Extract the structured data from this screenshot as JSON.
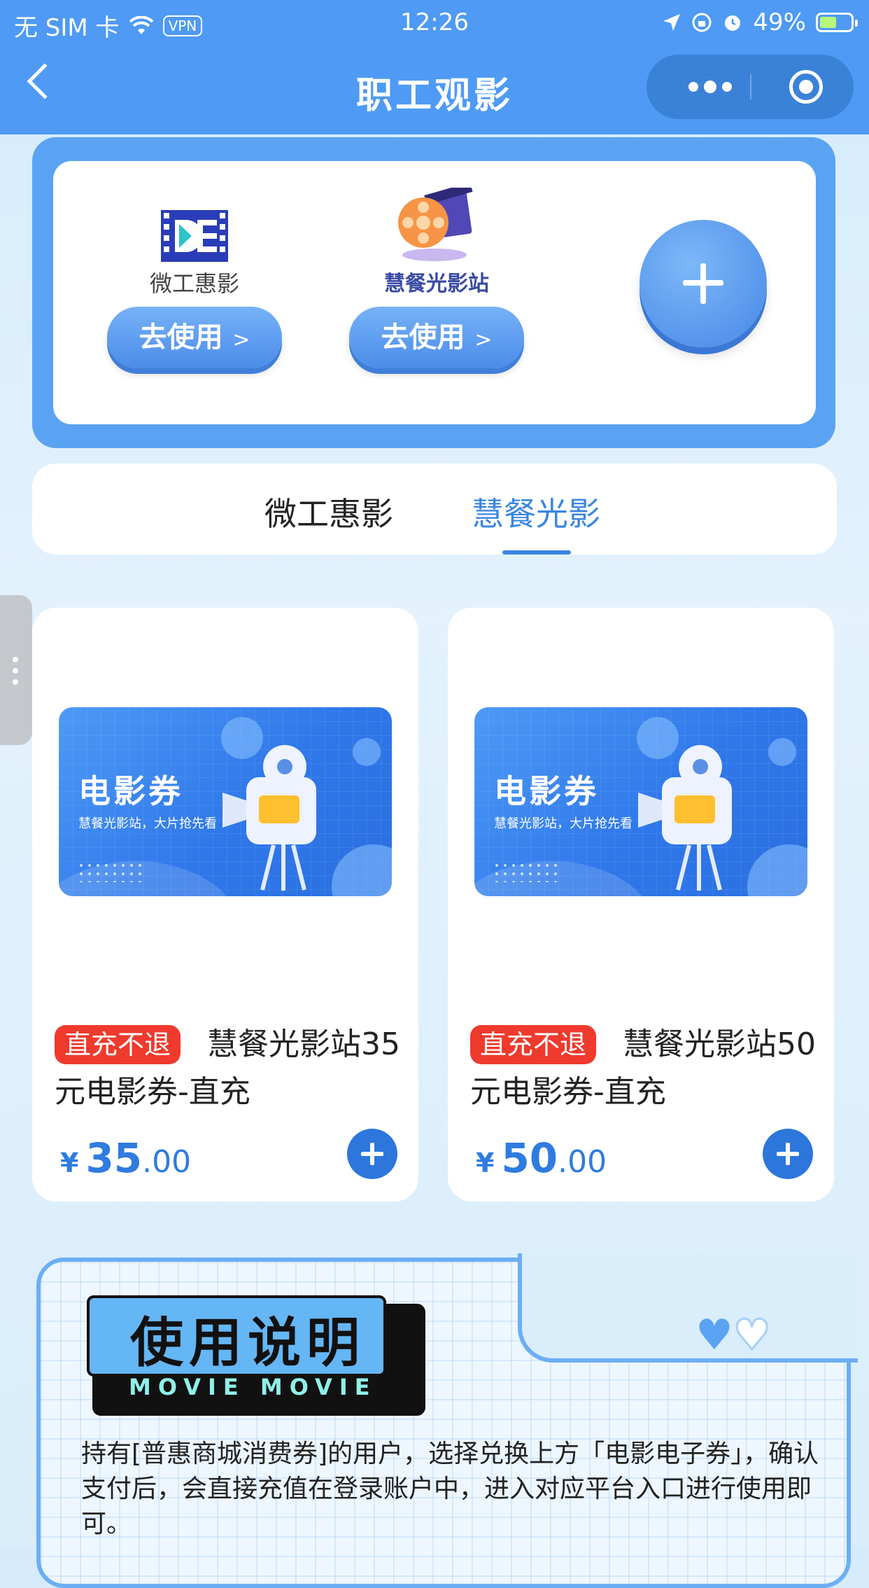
{
  "status_bar": {
    "carrier": "无 SIM 卡",
    "vpn": "VPN",
    "time": "12:26",
    "battery": "49%"
  },
  "nav": {
    "title": "职工观影"
  },
  "platforms": [
    {
      "name": "微工惠影",
      "button": "去使用",
      "arrow": ">"
    },
    {
      "name": "慧餐光影站",
      "button": "去使用",
      "arrow": ">"
    }
  ],
  "tabs": [
    {
      "label": "微工惠影",
      "active": false
    },
    {
      "label": "慧餐光影",
      "active": true
    }
  ],
  "products": [
    {
      "banner_title": "电影券",
      "banner_subtitle": "慧餐光影站，大片抢先看",
      "tag": "直充不退",
      "name": "慧餐光影站35元电影券-直充",
      "currency": "¥",
      "price_int": "35",
      "price_dec": ".00"
    },
    {
      "banner_title": "电影券",
      "banner_subtitle": "慧餐光影站，大片抢先看",
      "tag": "直充不退",
      "name": "慧餐光影站50元电影券-直充",
      "currency": "¥",
      "price_int": "50",
      "price_dec": ".00"
    }
  ],
  "notes": {
    "title": "使用说明",
    "subtitle": "MOVIE MOVIE",
    "text": "持有[普惠商城消费券]的用户，选择兑换上方「电影电子券」，确认支付后，会直接充值在登录账户中，进入对应平台入口进行使用即可。"
  },
  "colors": {
    "primary": "#4e9af4",
    "accent": "#3a86e0",
    "tag_red": "#ef3a2d"
  }
}
